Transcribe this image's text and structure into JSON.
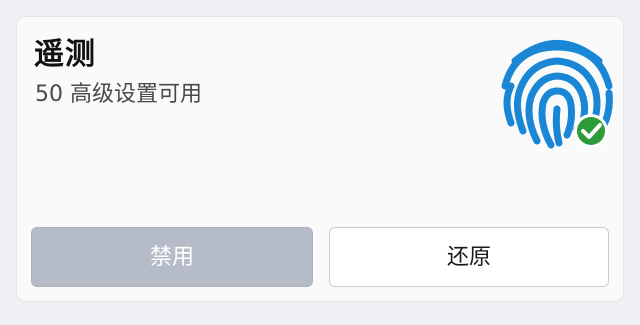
{
  "panel": {
    "title": "遥测",
    "subtitle": "50 高级设置可用",
    "icon": "fingerprint-check-icon"
  },
  "buttons": {
    "disable_label": "禁用",
    "restore_label": "还原"
  },
  "colors": {
    "fingerprint_blue": "#1a86d6",
    "check_green": "#2e9b3a",
    "disabled_button_bg": "#b5bcc7"
  }
}
